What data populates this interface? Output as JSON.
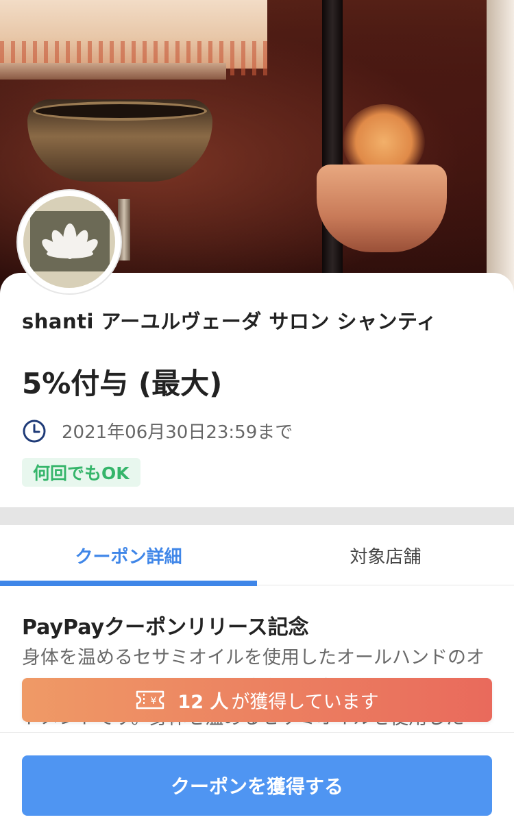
{
  "shop": {
    "name": "shanti アーユルヴェーダ サロン シャンティ",
    "avatar_icon": "lotus-icon"
  },
  "deal": {
    "title": "5%付与 (最大)",
    "deadline": "2021年06月30日23:59まで",
    "deadline_icon": "clock-icon",
    "badge": "何回でもOK"
  },
  "tabs": [
    {
      "label": "クーポン詳細",
      "active": true
    },
    {
      "label": "対象店舗",
      "active": false
    }
  ],
  "detail": {
    "title": "PayPayクーポンリリース記念",
    "body": "身体を温めるセサミオイルを使用したオールハンドのオイルトリートメントで、脳疲労を体身させる脳のトリートメントです。身体を温めるセサミオイルを使用した"
  },
  "acquired": {
    "icon": "ticket-icon",
    "count": "12 人",
    "text": "が獲得しています"
  },
  "cta": {
    "label": "クーポンを獲得する"
  },
  "colors": {
    "accent": "#3f86e8",
    "button": "#4f95f2",
    "badge_text": "#35b56a",
    "badge_bg": "#e8f7ee",
    "banner_start": "#ef9a66",
    "banner_end": "#e96a5c"
  }
}
